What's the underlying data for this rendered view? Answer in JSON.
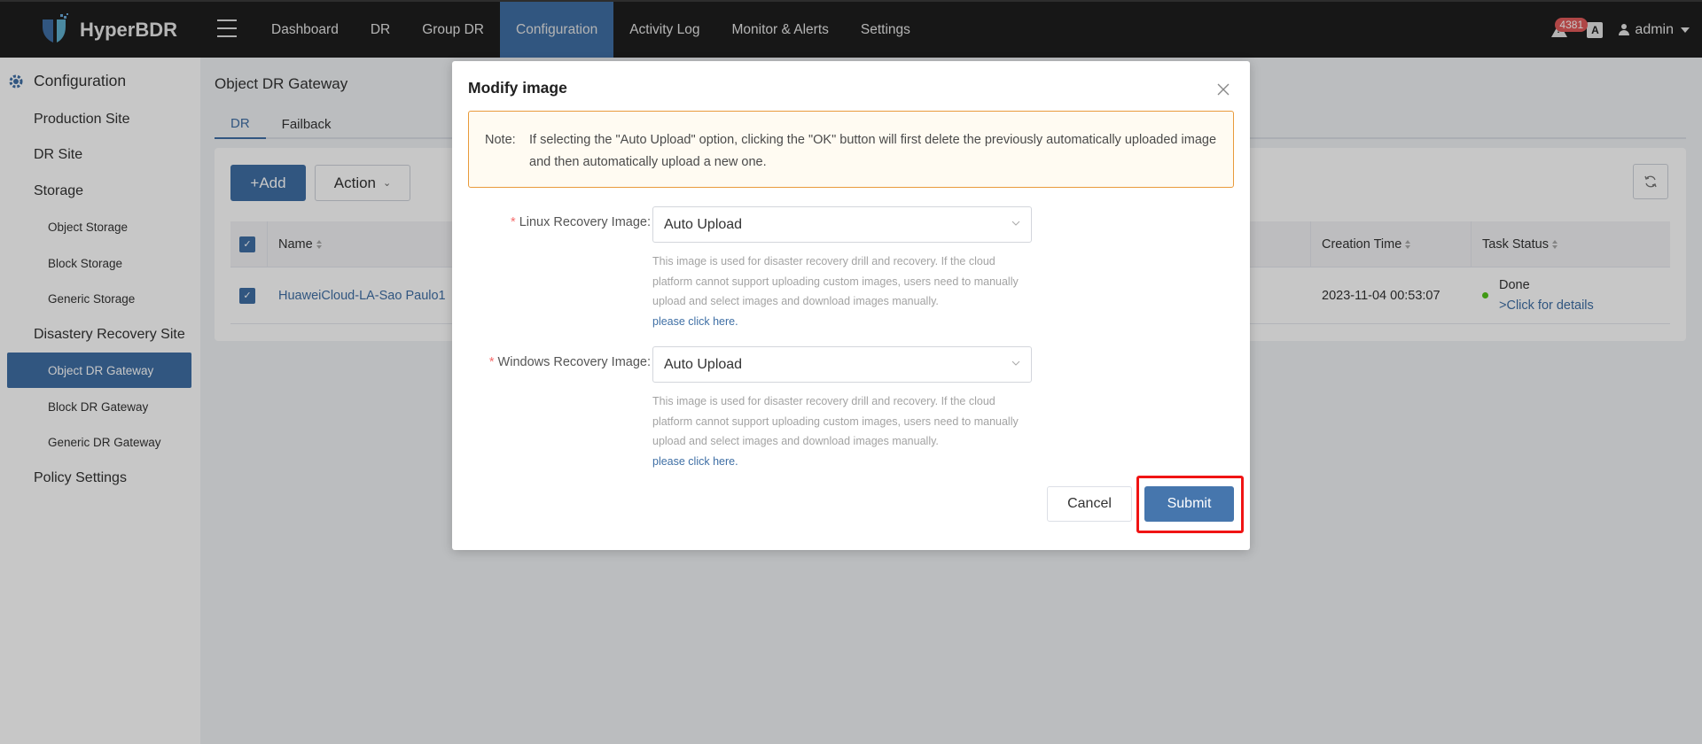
{
  "header": {
    "app_name": "HyperBDR",
    "nav": [
      {
        "label": "Dashboard",
        "active": false
      },
      {
        "label": "DR",
        "active": false
      },
      {
        "label": "Group DR",
        "active": false
      },
      {
        "label": "Configuration",
        "active": true
      },
      {
        "label": "Activity Log",
        "active": false
      },
      {
        "label": "Monitor & Alerts",
        "active": false
      },
      {
        "label": "Settings",
        "active": false
      }
    ],
    "alert_count": "4381",
    "translate_icon": "A",
    "user": "admin"
  },
  "sidebar": {
    "title": "Configuration",
    "items": [
      {
        "label": "Production Site",
        "level": 1
      },
      {
        "label": "DR Site",
        "level": 1
      },
      {
        "label": "Storage",
        "level": 1
      },
      {
        "label": "Object Storage",
        "level": 2
      },
      {
        "label": "Block Storage",
        "level": 2
      },
      {
        "label": "Generic Storage",
        "level": 2
      },
      {
        "label": "Disastery Recovery Site",
        "level": 1
      },
      {
        "label": "Object DR Gateway",
        "level": 2,
        "active": true
      },
      {
        "label": "Block DR Gateway",
        "level": 2
      },
      {
        "label": "Generic DR Gateway",
        "level": 2
      },
      {
        "label": "Policy Settings",
        "level": 1
      }
    ]
  },
  "main": {
    "title": "Object DR Gateway",
    "tabs": [
      {
        "label": "DR",
        "active": true
      },
      {
        "label": "Failback",
        "active": false
      }
    ],
    "toolbar": {
      "add_label": "+Add",
      "action_label": "Action"
    },
    "table": {
      "columns": [
        "Name",
        "Creation Time",
        "Task Status"
      ],
      "rows": [
        {
          "name": "HuaweiCloud-LA-Sao Paulo1",
          "creation_time": "2023-11-04 00:53:07",
          "status": "Done",
          "details_link": ">Click for details",
          "checked": true
        }
      ]
    }
  },
  "modal": {
    "title": "Modify image",
    "note_label": "Note:",
    "note_text": "If selecting the \"Auto Upload\" option, clicking the \"OK\" button will first delete the previously automatically uploaded image and then automatically upload a new one.",
    "fields": [
      {
        "label": "Linux Recovery Image:",
        "required": "*",
        "value": "Auto Upload",
        "help": "This image is used for disaster recovery drill and recovery. If the cloud platform cannot support uploading custom images, users need to manually upload and select images and download images manually.",
        "help_link": "please click here."
      },
      {
        "label": "Windows Recovery Image:",
        "required": "*",
        "value": "Auto Upload",
        "help": "This image is used for disaster recovery drill and recovery. If the cloud platform cannot support uploading custom images, users need to manually upload and select images and download images manually.",
        "help_link": "please click here."
      }
    ],
    "cancel_label": "Cancel",
    "submit_label": "Submit"
  },
  "colors": {
    "primary": "#3f6fa5",
    "header_bg": "#1e1e1e",
    "highlight": "#f01414",
    "status_done": "#52c41a",
    "note_border": "#e99a3c"
  }
}
